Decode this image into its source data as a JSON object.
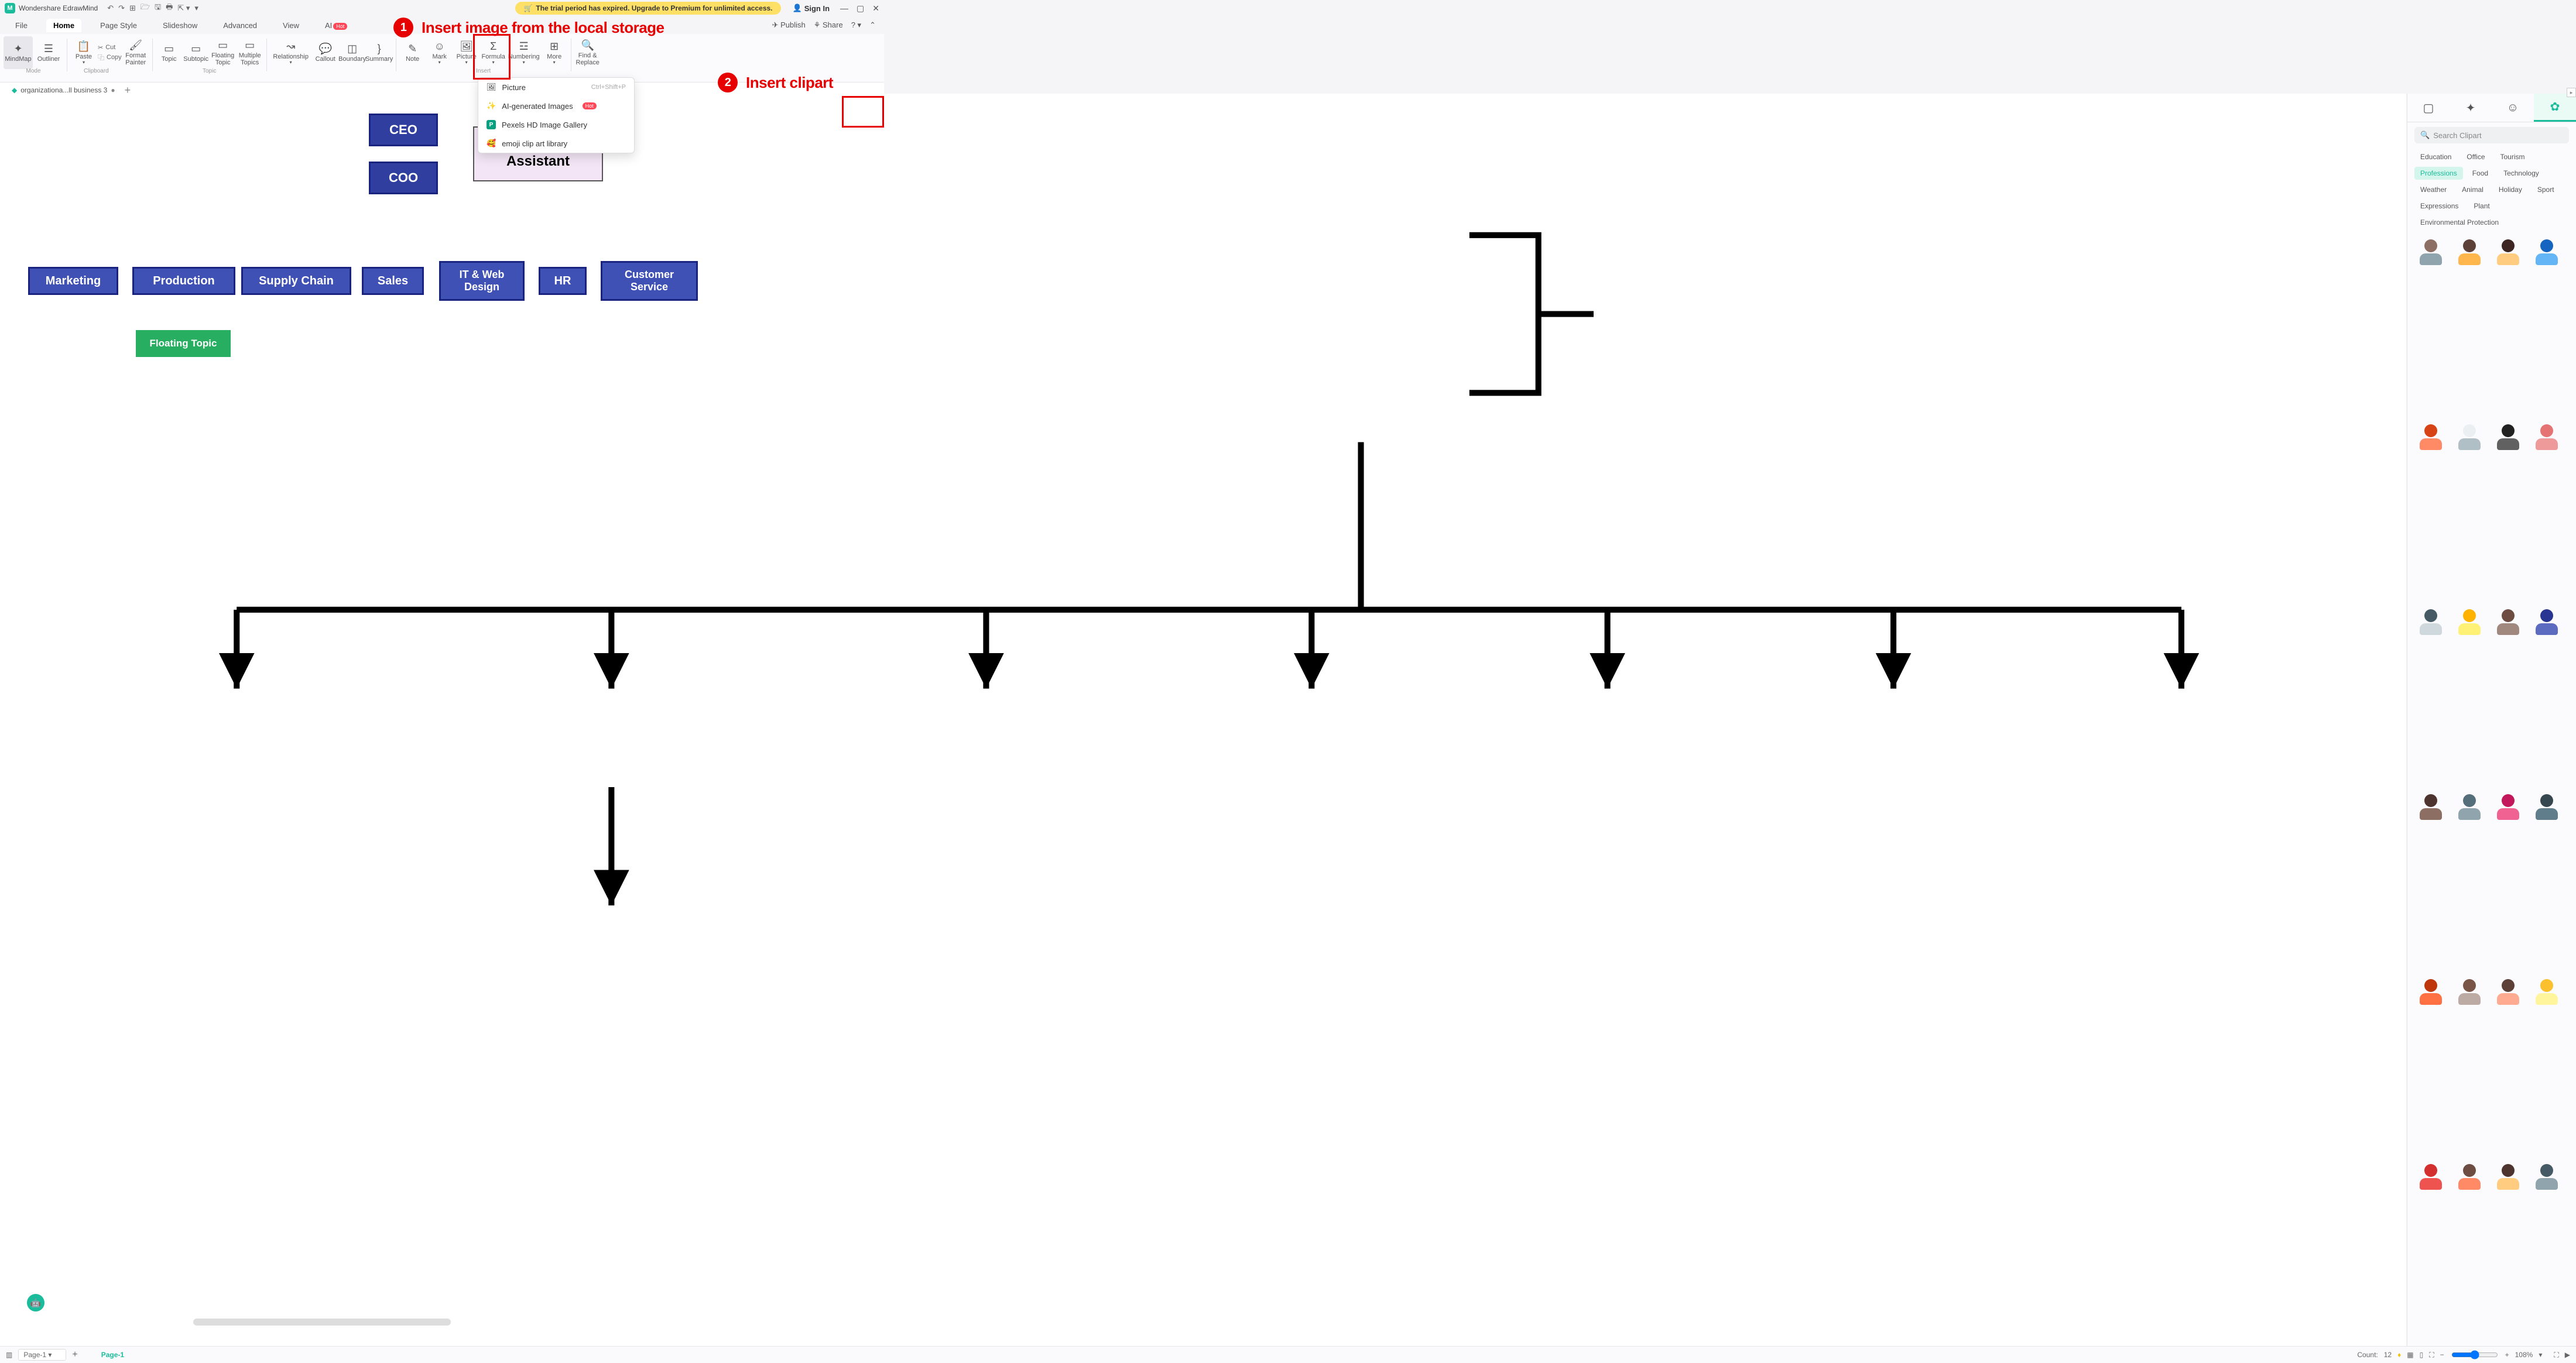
{
  "title_bar": {
    "app_name": "Wondershare EdrawMind",
    "sign_in": "Sign In"
  },
  "trial_banner": "The trial period has expired. Upgrade to Premium for unlimited access.",
  "menu": {
    "file": "File",
    "tabs": [
      "Home",
      "Page Style",
      "Slideshow",
      "Advanced",
      "View",
      "AI"
    ],
    "hot": "Hot",
    "publish": "Publish",
    "share": "Share"
  },
  "ribbon": {
    "mindmap": "MindMap",
    "outliner": "Outliner",
    "mode_label": "Mode",
    "paste": "Paste",
    "cut": "Cut",
    "copy": "Copy",
    "clipboard_label": "Clipboard",
    "format_painter": "Format\nPainter",
    "topic": "Topic",
    "subtopic": "Subtopic",
    "floating": "Floating\nTopic",
    "multiple": "Multiple\nTopics",
    "topic_label": "Topic",
    "relationship": "Relationship",
    "callout": "Callout",
    "boundary": "Boundary",
    "summary": "Summary",
    "note": "Note",
    "mark": "Mark",
    "picture": "Picture",
    "formula": "Formula",
    "numbering": "Numbering",
    "more": "More",
    "insert_label": "Insert",
    "find": "Find &\nReplace"
  },
  "doc_tab": "organizationa...ll business 3",
  "dropdown": {
    "picture": "Picture",
    "shortcut": "Ctrl+Shift+P",
    "ai": "AI-generated Images",
    "ai_hot": "Hot",
    "pexels": "Pexels HD Image Gallery",
    "emoji": "emoji clip art library"
  },
  "callouts": {
    "c1": "Insert image from the local storage",
    "c2": "Insert clipart"
  },
  "chart": {
    "ceo": "CEO",
    "coo": "COO",
    "exec": "Executive\nAssistant",
    "depts": [
      "Marketing",
      "Production",
      "Supply Chain",
      "Sales",
      "IT & Web\nDesign",
      "HR",
      "Customer\nService"
    ],
    "floating": "Floating Topic"
  },
  "side": {
    "search_placeholder": "Search Clipart",
    "cats": [
      "Education",
      "Office",
      "Tourism",
      "Professions",
      "Food",
      "Technology",
      "Weather",
      "Animal",
      "Holiday",
      "Sport",
      "Expressions",
      "Plant",
      "Environmental Protection"
    ],
    "active_cat": 3
  },
  "status": {
    "page_sel": "Page-1",
    "page_link": "Page-1",
    "count_label": "Count:",
    "count": "12",
    "zoom": "108%"
  },
  "avatar_colors": [
    [
      "#8d6e63",
      "#90a4ae"
    ],
    [
      "#5d4037",
      "#ffb74d"
    ],
    [
      "#3e2723",
      "#ffcc80"
    ],
    [
      "#1565c0",
      "#64b5f6"
    ],
    [
      "#d84315",
      "#ff8a65"
    ],
    [
      "#eceff1",
      "#b0bec5"
    ],
    [
      "#212121",
      "#616161"
    ],
    [
      "#e57373",
      "#ef9a9a"
    ],
    [
      "#455a64",
      "#cfd8dc"
    ],
    [
      "#ffb300",
      "#fff176"
    ],
    [
      "#6d4c41",
      "#a1887f"
    ],
    [
      "#283593",
      "#5c6bc0"
    ],
    [
      "#4e342e",
      "#8d6e63"
    ],
    [
      "#546e7a",
      "#90a4ae"
    ],
    [
      "#c2185b",
      "#f06292"
    ],
    [
      "#37474f",
      "#607d8b"
    ],
    [
      "#bf360c",
      "#ff7043"
    ],
    [
      "#795548",
      "#bcaaa4"
    ],
    [
      "#5d4037",
      "#ffab91"
    ],
    [
      "#fbc02d",
      "#fff59d"
    ],
    [
      "#d32f2f",
      "#ef5350"
    ],
    [
      "#6d4c41",
      "#ff8a65"
    ],
    [
      "#4e342e",
      "#ffcc80"
    ],
    [
      "#455a64",
      "#90a4ae"
    ]
  ]
}
